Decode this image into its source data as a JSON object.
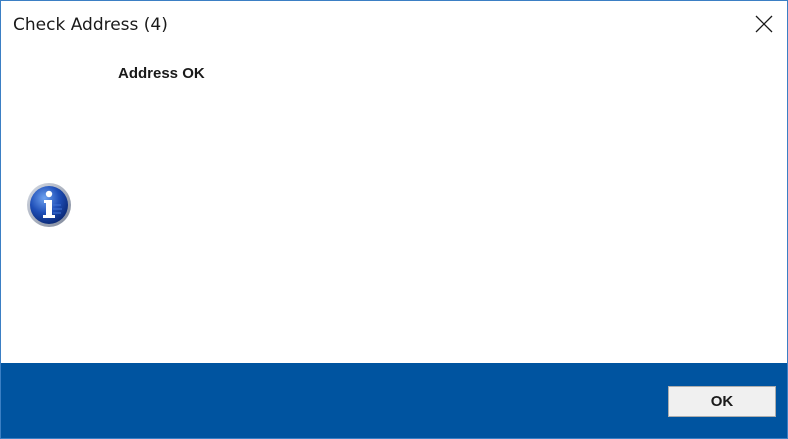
{
  "window": {
    "title": "Check Address (4)",
    "close_icon": "close-icon",
    "accent_color": "#3b7fc4"
  },
  "content": {
    "message": "Address OK",
    "icon": "info-icon"
  },
  "footer": {
    "background_color": "#0054a0",
    "ok_label": "OK"
  }
}
